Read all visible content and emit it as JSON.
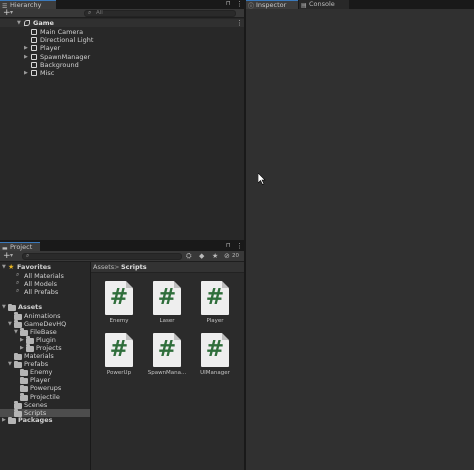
{
  "hierarchy": {
    "tab_label": "Hierarchy",
    "search_placeholder": "All",
    "scene": "Game",
    "items": [
      {
        "label": "Main Camera",
        "expandable": false
      },
      {
        "label": "Directional Light",
        "expandable": false
      },
      {
        "label": "Player",
        "expandable": true
      },
      {
        "label": "SpawnManager",
        "expandable": true
      },
      {
        "label": "Background",
        "expandable": false
      },
      {
        "label": "Misc",
        "expandable": true
      }
    ]
  },
  "inspector": {
    "tab_label": "Inspector"
  },
  "console": {
    "tab_label": "Console"
  },
  "project": {
    "tab_label": "Project",
    "hidden_count": "20",
    "breadcrumb": {
      "root": "Assets",
      "separator": ">",
      "current": "Scripts"
    },
    "favorites": {
      "label": "Favorites",
      "items": [
        "All Materials",
        "All Models",
        "All Prefabs"
      ]
    },
    "assets_label": "Assets",
    "tree": [
      {
        "label": "Animations",
        "depth": 1,
        "expandable": false,
        "open": false
      },
      {
        "label": "GameDevHQ",
        "depth": 1,
        "expandable": true,
        "open": true
      },
      {
        "label": "FileBase",
        "depth": 2,
        "expandable": true,
        "open": true
      },
      {
        "label": "Plugin",
        "depth": 3,
        "expandable": true,
        "open": false
      },
      {
        "label": "Projects",
        "depth": 3,
        "expandable": true,
        "open": false
      },
      {
        "label": "Materials",
        "depth": 1,
        "expandable": false,
        "open": false
      },
      {
        "label": "Prefabs",
        "depth": 1,
        "expandable": true,
        "open": true
      },
      {
        "label": "Enemy",
        "depth": 2,
        "expandable": false,
        "open": false
      },
      {
        "label": "Player",
        "depth": 2,
        "expandable": false,
        "open": false
      },
      {
        "label": "Powerups",
        "depth": 2,
        "expandable": false,
        "open": false
      },
      {
        "label": "Projectile",
        "depth": 2,
        "expandable": false,
        "open": false
      },
      {
        "label": "Scenes",
        "depth": 1,
        "expandable": false,
        "open": false
      },
      {
        "label": "Scripts",
        "depth": 1,
        "expandable": false,
        "open": false,
        "selected": true
      }
    ],
    "packages_label": "Packages",
    "files": [
      "Enemy",
      "Laser",
      "Player",
      "PowerUp",
      "SpawnMana...",
      "UIManager"
    ],
    "script_glyph": "#"
  },
  "icons": {
    "add": "+",
    "dropdown": "▾",
    "lock": "🔒",
    "more": "⋮",
    "search": "⌕",
    "star": "★",
    "expand": "▶",
    "collapse": "▼",
    "tag": "◆",
    "eye": "⊘"
  },
  "colors": {
    "accent_tab": "#3a79bb",
    "script_hash": "#2f6e3b",
    "favorites_star": "#e6b422",
    "selection": "#4d4d4d"
  }
}
